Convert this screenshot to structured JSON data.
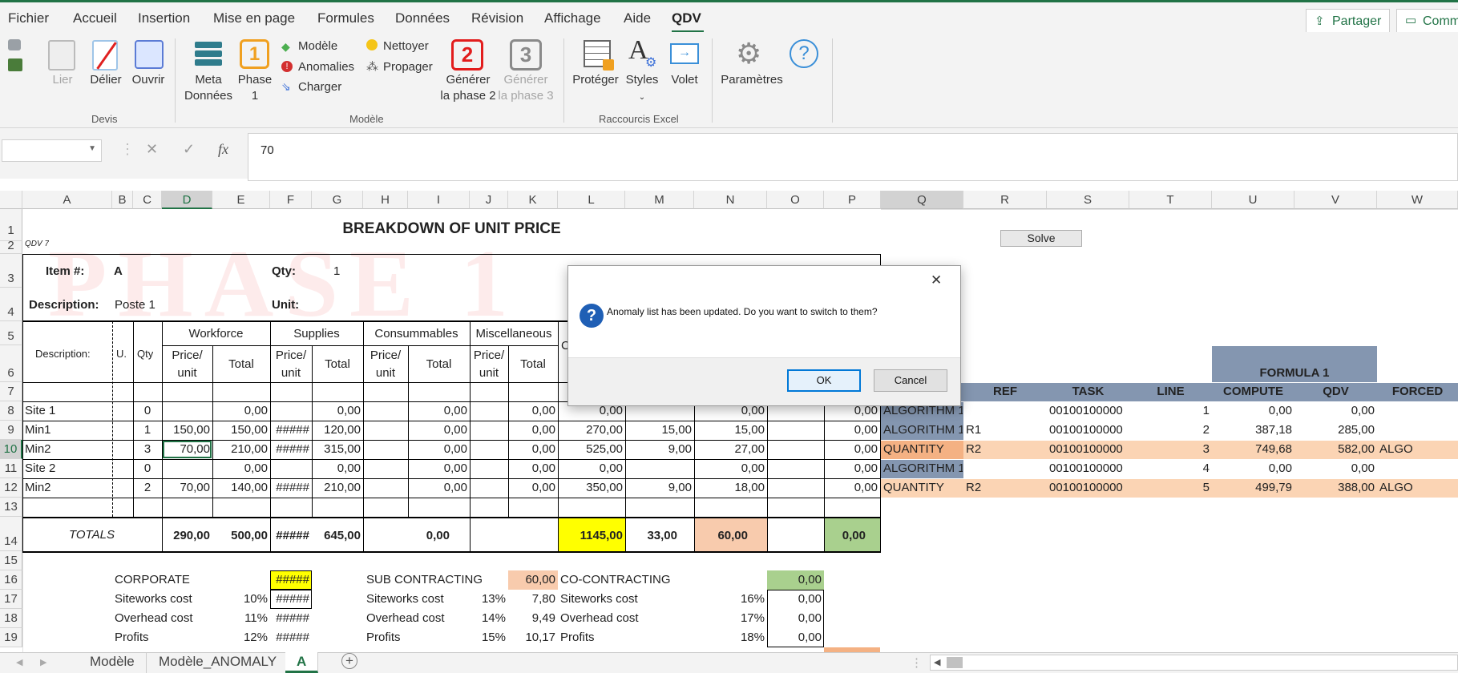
{
  "menu": {
    "tabs": [
      "Fichier",
      "Accueil",
      "Insertion",
      "Mise en page",
      "Formules",
      "Données",
      "Révision",
      "Affichage",
      "Aide",
      "QDV"
    ],
    "active": "QDV",
    "share": "Partager",
    "comments": "Comm"
  },
  "ribbon": {
    "lier": "Lier",
    "delier": "Délier",
    "ouvrir": "Ouvrir",
    "group_devis": "Devis",
    "meta1": "Meta",
    "meta2": "Données",
    "phase_num": "1",
    "phase1a": "Phase",
    "phase1b": "1",
    "modele": "Modèle",
    "anomalies": "Anomalies",
    "charger": "Charger",
    "nettoyer": "Nettoyer",
    "propager": "Propager",
    "gen2_num": "2",
    "gen2a": "Générer",
    "gen2b": "la phase 2",
    "gen3_num": "3",
    "gen3a": "Générer",
    "gen3b": "la phase 3",
    "group_modele": "Modèle",
    "proteger": "Protéger",
    "styles": "Styles",
    "volet": "Volet",
    "group_raccourcis": "Raccourcis Excel",
    "parametres": "Paramètres",
    "help": "?"
  },
  "formula_bar": {
    "fx": "fx",
    "value": "70"
  },
  "columns": [
    "A",
    "B",
    "C",
    "D",
    "E",
    "F",
    "G",
    "H",
    "I",
    "J",
    "K",
    "L",
    "M",
    "N",
    "O",
    "P",
    "Q",
    "R",
    "S",
    "T",
    "U",
    "V",
    "W"
  ],
  "selected_col": "D",
  "rows": [
    "1",
    "2",
    "3",
    "4",
    "5",
    "6",
    "7",
    "8",
    "9",
    "10",
    "11",
    "12",
    "13",
    "14",
    "15",
    "16",
    "17",
    "18",
    "19"
  ],
  "selected_row": "10",
  "watermark": "PHASE 1",
  "sheet": {
    "title": "BREAKDOWN OF UNIT PRICE",
    "qdv": "QDV 7",
    "item_label": "Item #:",
    "item_value": "A",
    "qty_label": "Qty:",
    "qty_value": "1",
    "desc_label": "Description:",
    "desc_value": "Poste 1",
    "unit_label": "Unit:",
    "col_desc": "Description:",
    "col_u": "U.",
    "col_qty": "Qty",
    "workforce": "Workforce",
    "supplies": "Supplies",
    "consummables": "Consummables",
    "misc": "Miscellaneous",
    "price": "Price/",
    "unit": "unit",
    "total": "Total",
    "o_partial": "C",
    "lines": [
      {
        "name": "Site 1",
        "qty": "0",
        "d": "",
        "e": "0,00",
        "f": "",
        "g": "0,00",
        "i": "0,00",
        "k": "0,00",
        "l": "0,00",
        "m": "",
        "n": "0,00",
        "p": "0,00"
      },
      {
        "name": "Min1",
        "qty": "1",
        "d": "150,00",
        "e": "150,00",
        "f": "#####",
        "g": "120,00",
        "i": "0,00",
        "k": "0,00",
        "l": "270,00",
        "m": "15,00",
        "n": "15,00",
        "p": "0,00"
      },
      {
        "name": "Min2",
        "qty": "3",
        "d": "70,00",
        "e": "210,00",
        "f": "#####",
        "g": "315,00",
        "i": "0,00",
        "k": "0,00",
        "l": "525,00",
        "m": "9,00",
        "n": "27,00",
        "p": "0,00"
      },
      {
        "name": "Site 2",
        "qty": "0",
        "d": "",
        "e": "0,00",
        "f": "",
        "g": "0,00",
        "i": "0,00",
        "k": "0,00",
        "l": "0,00",
        "m": "",
        "n": "0,00",
        "p": "0,00"
      },
      {
        "name": "Min2",
        "qty": "2",
        "d": "70,00",
        "e": "140,00",
        "f": "#####",
        "g": "210,00",
        "i": "0,00",
        "k": "0,00",
        "l": "350,00",
        "m": "9,00",
        "n": "18,00",
        "p": "0,00"
      }
    ],
    "totals": {
      "label": "TOTALS",
      "d": "290,00",
      "e": "500,00",
      "f": "#####",
      "g": "645,00",
      "i": "0,00",
      "l": "1145,00",
      "m": "33,00",
      "n": "60,00",
      "p": "0,00"
    },
    "corporate": {
      "label": "CORPORATE",
      "value": "#####",
      "rows": [
        {
          "label": "Siteworks cost",
          "pct": "10%",
          "val": "#####"
        },
        {
          "label": "Overhead cost",
          "pct": "11%",
          "val": "#####"
        },
        {
          "label": "Profits",
          "pct": "12%",
          "val": "#####"
        }
      ]
    },
    "subcontracting": {
      "label": "SUB CONTRACTING",
      "value": "60,00",
      "rows": [
        {
          "label": "Siteworks cost",
          "pct": "13%",
          "val": "7,80"
        },
        {
          "label": "Overhead cost",
          "pct": "14%",
          "val": "9,49"
        },
        {
          "label": "Profits",
          "pct": "15%",
          "val": "10,17"
        }
      ]
    },
    "cocontracting": {
      "label": "CO-CONTRACTING",
      "value": "0,00",
      "rows": [
        {
          "label": "Siteworks cost",
          "pct": "16%",
          "val": "0,00"
        },
        {
          "label": "Overhead cost",
          "pct": "17%",
          "val": "0,00"
        },
        {
          "label": "Profits",
          "pct": "18%",
          "val": "0,00"
        }
      ]
    }
  },
  "right_table": {
    "solve": "Solve",
    "formula_header": "FORMULA 1",
    "headers": [
      "REF",
      "TASK",
      "LINE",
      "COMPUTE",
      "QDV",
      "FORCED"
    ],
    "rows": [
      {
        "q": "ALGORITHM 1",
        "ref": "",
        "task": "00100100000",
        "line": "1",
        "compute": "0,00",
        "qdv": "0,00",
        "forced": ""
      },
      {
        "q": "ALGORITHM 1",
        "ref": "R1",
        "task": "00100100000",
        "line": "2",
        "compute": "387,18",
        "qdv": "285,00",
        "forced": ""
      },
      {
        "q": "QUANTITY",
        "ref": "R2",
        "task": "00100100000",
        "line": "3",
        "compute": "749,68",
        "qdv": "582,00",
        "forced": "ALGO"
      },
      {
        "q": "ALGORITHM 1",
        "ref": "",
        "task": "00100100000",
        "line": "4",
        "compute": "0,00",
        "qdv": "0,00",
        "forced": ""
      },
      {
        "q": "QUANTITY",
        "ref": "R2",
        "task": "00100100000",
        "line": "5",
        "compute": "499,79",
        "qdv": "388,00",
        "forced": "ALGO"
      }
    ]
  },
  "sheets": {
    "tabs": [
      "Modèle",
      "Modèle_ANOMALY",
      "A"
    ],
    "active": "A"
  },
  "dialog": {
    "message": "Anomaly list has been updated. Do you want to switch to them?",
    "ok": "OK",
    "cancel": "Cancel"
  },
  "colors": {
    "excel_green": "#217346",
    "yellow": "#ffff00",
    "salmon": "#f8cbad",
    "green_total": "#a9d08e",
    "slate": "#8496b0",
    "orange_row": "#fbd4b4"
  }
}
